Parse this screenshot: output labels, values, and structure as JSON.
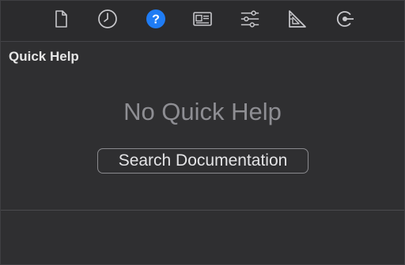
{
  "toolbar": {
    "icons": [
      {
        "name": "file-inspector-icon",
        "active": false
      },
      {
        "name": "history-clock-icon",
        "active": false
      },
      {
        "name": "quick-help-icon",
        "active": true,
        "glyph": "?"
      },
      {
        "name": "identity-inspector-icon",
        "active": false
      },
      {
        "name": "attributes-sliders-icon",
        "active": false
      },
      {
        "name": "size-ruler-icon",
        "active": false
      },
      {
        "name": "connections-icon",
        "active": false
      }
    ],
    "active_color": "#1f7cf4",
    "icon_color": "#c8c8cc"
  },
  "panel": {
    "title": "Quick Help",
    "empty_message": "No Quick Help",
    "search_label": "Search Documentation"
  }
}
